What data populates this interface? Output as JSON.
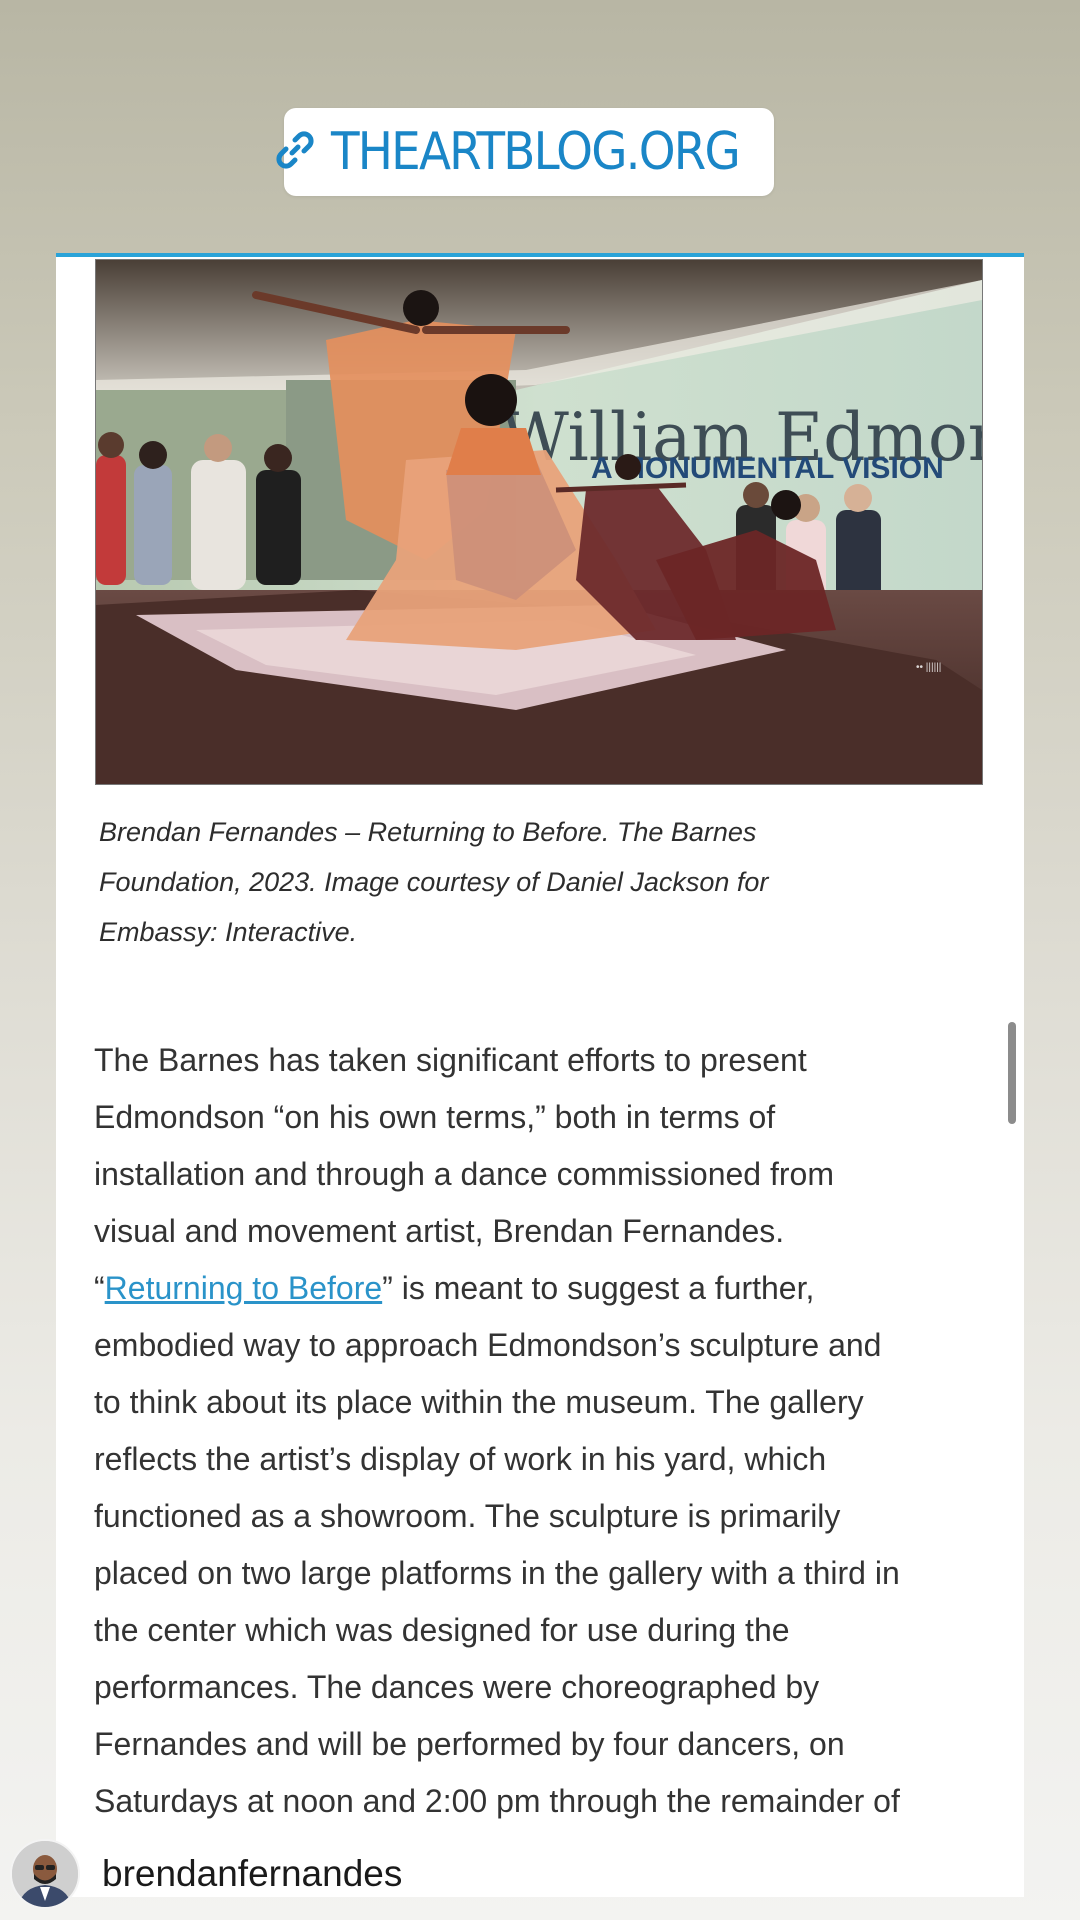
{
  "sticker": {
    "icon": "link-icon",
    "label": "THEARTBLOG.ORG",
    "color": "#1a86c7"
  },
  "article": {
    "image": {
      "wall_title": "William Edmondson",
      "wall_subtitle": "A MONUMENTAL VISION"
    },
    "caption_lines": [
      "Brendan Fernandes – Returning to Before. The Barnes",
      "Foundation, 2023. Image courtesy of Daniel Jackson for",
      "Embassy: Interactive."
    ],
    "body": {
      "line1": "The Barnes has taken significant efforts to present",
      "line2": "Edmondson “on his own terms,” both in terms of",
      "line3": "installation and through a dance commissioned from",
      "line4": "visual and movement artist, Brendan Fernandes.",
      "line5_open_quote": "“",
      "line5_link": "Returning to Before",
      "line5_rest": "” is meant to suggest a further,",
      "line6": "embodied way to approach Edmondson’s sculpture and",
      "line7": "to think about its place within the museum. The gallery",
      "line8": "reflects the artist’s display of work in his yard, which",
      "line9": "functioned as a showroom. The sculpture is primarily",
      "line10": "placed on two large platforms in the gallery with a third in",
      "line11": "the center which was designed for use during the",
      "line12": "performances. The dances were choreographed by",
      "line13": "Fernandes and will be performed by four dancers, on",
      "line14": "Saturdays at noon and 2:00 pm through the remainder of"
    },
    "link_color": "#2a93c9",
    "accent_color": "#2aa3d8"
  },
  "profile": {
    "username": "brendanfernandes",
    "avatar_icon": "avatar"
  }
}
